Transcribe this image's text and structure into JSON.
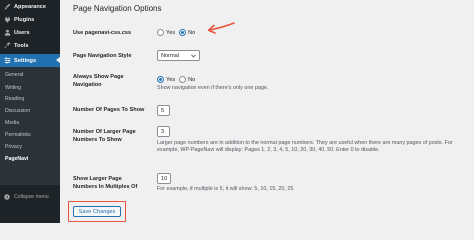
{
  "sidebar": {
    "items": [
      {
        "label": "Appearance",
        "icon": "paintbrush-icon"
      },
      {
        "label": "Plugins",
        "icon": "plugin-icon"
      },
      {
        "label": "Users",
        "icon": "users-icon"
      },
      {
        "label": "Tools",
        "icon": "wrench-icon"
      },
      {
        "label": "Settings",
        "icon": "settings-icon"
      }
    ],
    "submenu": [
      "General",
      "Writing",
      "Reading",
      "Discussion",
      "Media",
      "Permalinks",
      "Privacy",
      "PageNavi"
    ],
    "collapse_label": "Collapse menu"
  },
  "page": {
    "title": "Page Navigation Options"
  },
  "options": {
    "css": {
      "label": "Use pagenavi-css.css",
      "yes": "Yes",
      "no": "No",
      "selected": "No"
    },
    "style": {
      "label": "Page Navigation Style",
      "value": "Normal"
    },
    "always_show": {
      "label": "Always Show Page Navigation",
      "yes": "Yes",
      "no": "No",
      "selected": "Yes",
      "description": "Show navigation even if there's only one page."
    },
    "pages_to_show": {
      "label": "Number Of Pages To Show",
      "value": "5"
    },
    "larger_pages": {
      "label": "Number Of Larger Page Numbers To Show",
      "value": "3",
      "description": "Larger page numbers are in addition to the normal page numbers. They are useful when there are many pages of posts. For example, WP-PageNavi will display: Pages 1, 2, 3, 4, 5, 10, 20, 30, 40, 50. Enter 0 to disable."
    },
    "multiples": {
      "label": "Show Larger Page Numbers In Multiples Of",
      "value": "10",
      "description": "For example, if multiple is 5, it will show: 5, 10, 15, 20, 25"
    }
  },
  "save_button": "Save Changes",
  "colors": {
    "sidebar_bg": "#1d2327",
    "submenu_bg": "#2c3338",
    "accent": "#2271b1",
    "annotation": "#e8543e"
  }
}
